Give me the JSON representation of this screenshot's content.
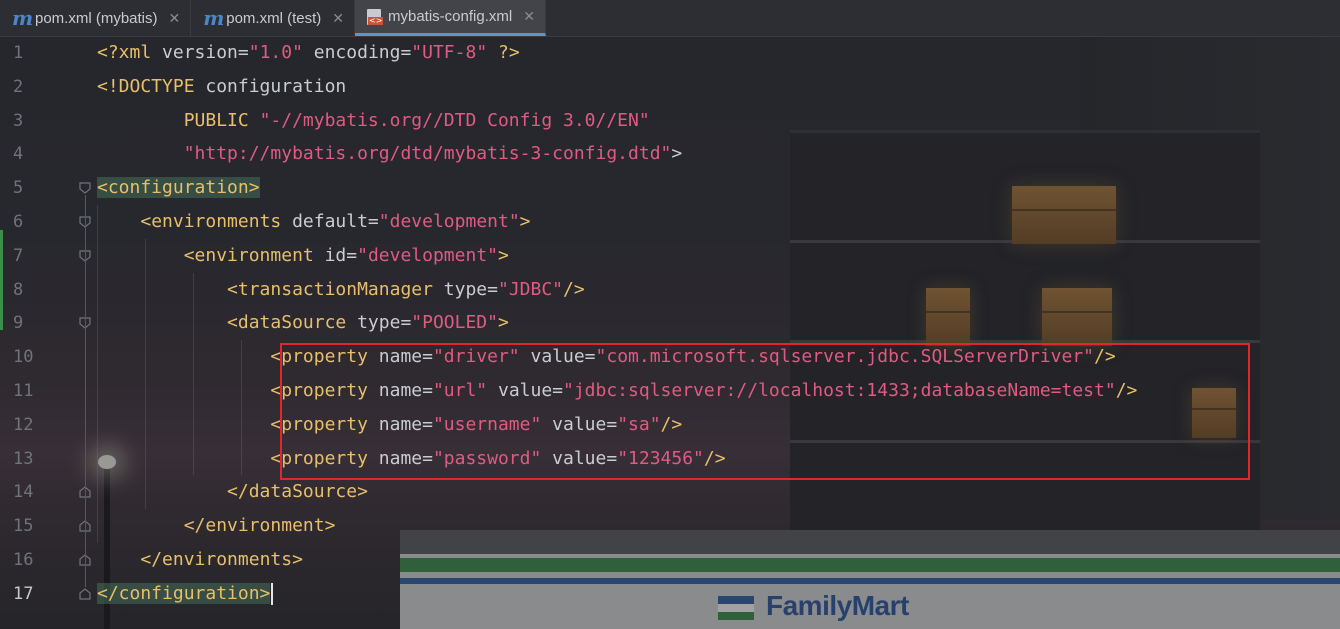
{
  "tabs": [
    {
      "label": "pom.xml (mybatis)",
      "icon": "maven-icon",
      "active": false
    },
    {
      "label": "pom.xml (test)",
      "icon": "maven-icon",
      "active": false
    },
    {
      "label": "mybatis-config.xml",
      "icon": "xml-file-icon",
      "active": true
    }
  ],
  "editor": {
    "line_numbers": [
      "1",
      "2",
      "3",
      "4",
      "5",
      "6",
      "7",
      "8",
      "9",
      "10",
      "11",
      "12",
      "13",
      "14",
      "15",
      "16",
      "17"
    ],
    "current_line": "17",
    "lines": [
      [
        [
          "decl",
          "<?xml "
        ],
        [
          "attr",
          "version="
        ],
        [
          "str",
          "\"1.0\""
        ],
        [
          "attr",
          " encoding="
        ],
        [
          "str",
          "\"UTF-8\""
        ],
        [
          "decl",
          " ?>"
        ]
      ],
      [
        [
          "decl",
          "<!DOCTYPE "
        ],
        [
          "plain",
          "configuration"
        ]
      ],
      [
        [
          "plain",
          "        "
        ],
        [
          "decl",
          "PUBLIC "
        ],
        [
          "str",
          "\"-//mybatis.org//DTD Config 3.0//EN\""
        ]
      ],
      [
        [
          "plain",
          "        "
        ],
        [
          "str",
          "\"http://mybatis.org/dtd/mybatis-3-config.dtd\""
        ],
        [
          "plain",
          ">"
        ]
      ],
      [
        [
          "tag",
          "<configuration>"
        ]
      ],
      [
        [
          "plain",
          "    "
        ],
        [
          "tag",
          "<environments "
        ],
        [
          "attr",
          "default="
        ],
        [
          "str",
          "\"development\""
        ],
        [
          "tag",
          ">"
        ]
      ],
      [
        [
          "plain",
          "        "
        ],
        [
          "tag",
          "<environment "
        ],
        [
          "attr",
          "id="
        ],
        [
          "str",
          "\"development\""
        ],
        [
          "tag",
          ">"
        ]
      ],
      [
        [
          "plain",
          "            "
        ],
        [
          "tag",
          "<transactionManager "
        ],
        [
          "attr",
          "type="
        ],
        [
          "str",
          "\"JDBC\""
        ],
        [
          "tag",
          "/>"
        ]
      ],
      [
        [
          "plain",
          "            "
        ],
        [
          "tag",
          "<dataSource "
        ],
        [
          "attr",
          "type="
        ],
        [
          "str",
          "\"POOLED\""
        ],
        [
          "tag",
          ">"
        ]
      ],
      [
        [
          "plain",
          "                "
        ],
        [
          "tag",
          "<property "
        ],
        [
          "attr",
          "name="
        ],
        [
          "str",
          "\"driver\""
        ],
        [
          "attr",
          " value="
        ],
        [
          "str",
          "\"com.microsoft.sqlserver.jdbc.SQLServerDriver\""
        ],
        [
          "tag",
          "/>"
        ]
      ],
      [
        [
          "plain",
          "                "
        ],
        [
          "tag",
          "<property "
        ],
        [
          "attr",
          "name="
        ],
        [
          "str",
          "\"url\""
        ],
        [
          "attr",
          " value="
        ],
        [
          "str",
          "\"jdbc:sqlserver://localhost:1433;databaseName=test\""
        ],
        [
          "tag",
          "/>"
        ]
      ],
      [
        [
          "plain",
          "                "
        ],
        [
          "tag",
          "<property "
        ],
        [
          "attr",
          "name="
        ],
        [
          "str",
          "\"username\""
        ],
        [
          "attr",
          " value="
        ],
        [
          "str",
          "\"sa\""
        ],
        [
          "tag",
          "/>"
        ]
      ],
      [
        [
          "plain",
          "                "
        ],
        [
          "tag",
          "<property "
        ],
        [
          "attr",
          "name="
        ],
        [
          "str",
          "\"password\""
        ],
        [
          "attr",
          " value="
        ],
        [
          "str",
          "\"123456\""
        ],
        [
          "tag",
          "/>"
        ]
      ],
      [
        [
          "plain",
          "            "
        ],
        [
          "tag",
          "</dataSource>"
        ]
      ],
      [
        [
          "plain",
          "        "
        ],
        [
          "tag",
          "</environment>"
        ]
      ],
      [
        [
          "plain",
          "    "
        ],
        [
          "tag",
          "</environments>"
        ]
      ],
      [
        [
          "tag",
          "</configuration>"
        ]
      ]
    ]
  },
  "background_logo": "FamilyMart",
  "colors": {
    "tag": "#e8bf6a",
    "string": "#e05b82",
    "text": "#c9ccd1",
    "highlight_box": "#e3262b",
    "active_tab_underline": "#5d95c9"
  }
}
